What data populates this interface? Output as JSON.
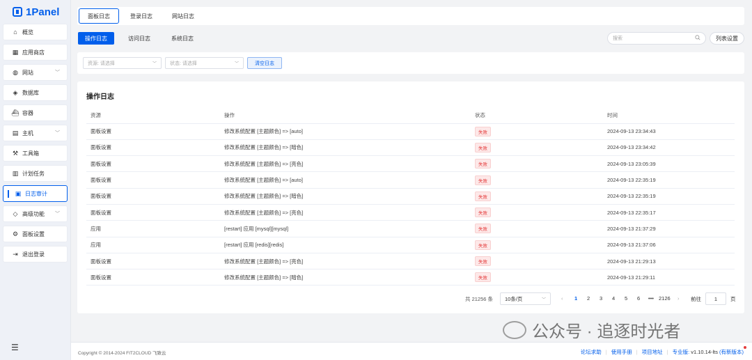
{
  "app": {
    "logo_text": "1Panel"
  },
  "sidebar": {
    "items": [
      {
        "label": "概览",
        "icon": "home-icon",
        "glyph": "⌂"
      },
      {
        "label": "应用商店",
        "icon": "grid-icon",
        "glyph": "▦"
      },
      {
        "label": "网站",
        "icon": "globe-icon",
        "glyph": "◍",
        "chevron": "﹀"
      },
      {
        "label": "数据库",
        "icon": "database-icon",
        "glyph": "◈"
      },
      {
        "label": "容器",
        "icon": "container-icon",
        "glyph": "⛴"
      },
      {
        "label": "主机",
        "icon": "server-icon",
        "glyph": "▤",
        "chevron": "﹀"
      },
      {
        "label": "工具箱",
        "icon": "toolbox-icon",
        "glyph": "⚒"
      },
      {
        "label": "计划任务",
        "icon": "calendar-icon",
        "glyph": "▥"
      },
      {
        "label": "日志审计",
        "icon": "log-icon",
        "glyph": "▣"
      },
      {
        "label": "高级功能",
        "icon": "diamond-icon",
        "glyph": "◇",
        "chevron": "﹀"
      },
      {
        "label": "面板设置",
        "icon": "gear-icon",
        "glyph": "⚙"
      },
      {
        "label": "退出登录",
        "icon": "logout-icon",
        "glyph": "⇥"
      }
    ],
    "active_index": 8
  },
  "top_tabs": [
    "面板日志",
    "登录日志",
    "网站日志"
  ],
  "sub_tabs": [
    "操作日志",
    "访问日志",
    "系统日志"
  ],
  "search": {
    "placeholder": "搜索"
  },
  "column_settings_label": "列表设置",
  "filters": {
    "resource_placeholder": "资源: 请选择",
    "status_placeholder": "状态: 请选择",
    "clear_label": "清空日志"
  },
  "table": {
    "title": "操作日志",
    "headers": [
      "资源",
      "操作",
      "状态",
      "时间"
    ],
    "rows": [
      [
        "面板设置",
        "修改系统配置 [主题颜色] => [auto]",
        "失败",
        "2024-09-13 23:34:43"
      ],
      [
        "面板设置",
        "修改系统配置 [主题颜色] => [暗色]",
        "失败",
        "2024-09-13 23:34:42"
      ],
      [
        "面板设置",
        "修改系统配置 [主题颜色] => [亮色]",
        "失败",
        "2024-09-13 23:05:39"
      ],
      [
        "面板设置",
        "修改系统配置 [主题颜色] => [auto]",
        "失败",
        "2024-09-13 22:35:19"
      ],
      [
        "面板设置",
        "修改系统配置 [主题颜色] => [暗色]",
        "失败",
        "2024-09-13 22:35:19"
      ],
      [
        "面板设置",
        "修改系统配置 [主题颜色] => [亮色]",
        "失败",
        "2024-09-13 22:35:17"
      ],
      [
        "应用",
        "[restart] 应用 [mysql][mysql]",
        "失败",
        "2024-09-13 21:37:29"
      ],
      [
        "应用",
        "[restart] 应用 [redis][redis]",
        "失败",
        "2024-09-13 21:37:06"
      ],
      [
        "面板设置",
        "修改系统配置 [主题颜色] => [亮色]",
        "失败",
        "2024-09-13 21:29:13"
      ],
      [
        "面板设置",
        "修改系统配置 [主题颜色] => [暗色]",
        "失败",
        "2024-09-13 21:29:11"
      ]
    ]
  },
  "pagination": {
    "total": "共 21256 条",
    "page_size": "10条/页",
    "prev": "‹",
    "next": "›",
    "pages": [
      "1",
      "2",
      "3",
      "4",
      "5",
      "6",
      "•••",
      "2126"
    ],
    "current": "1",
    "goto_label": "前往",
    "goto_value": "1",
    "page_suffix": "页"
  },
  "watermark": {
    "text": "公众号 · 追逐时光者"
  },
  "footer": {
    "copyright": "Copyright © 2014-2024 FIT2CLOUD 飞致云",
    "links": [
      "论坛求助",
      "使用手册",
      "项目地址"
    ],
    "edition_label": "专业版:",
    "version": "v1.10.14-lts",
    "new_version": "(有新版本)"
  },
  "colors": {
    "primary": "#005eeb",
    "danger": "#e43c3c",
    "background": "#f2f3f5"
  }
}
